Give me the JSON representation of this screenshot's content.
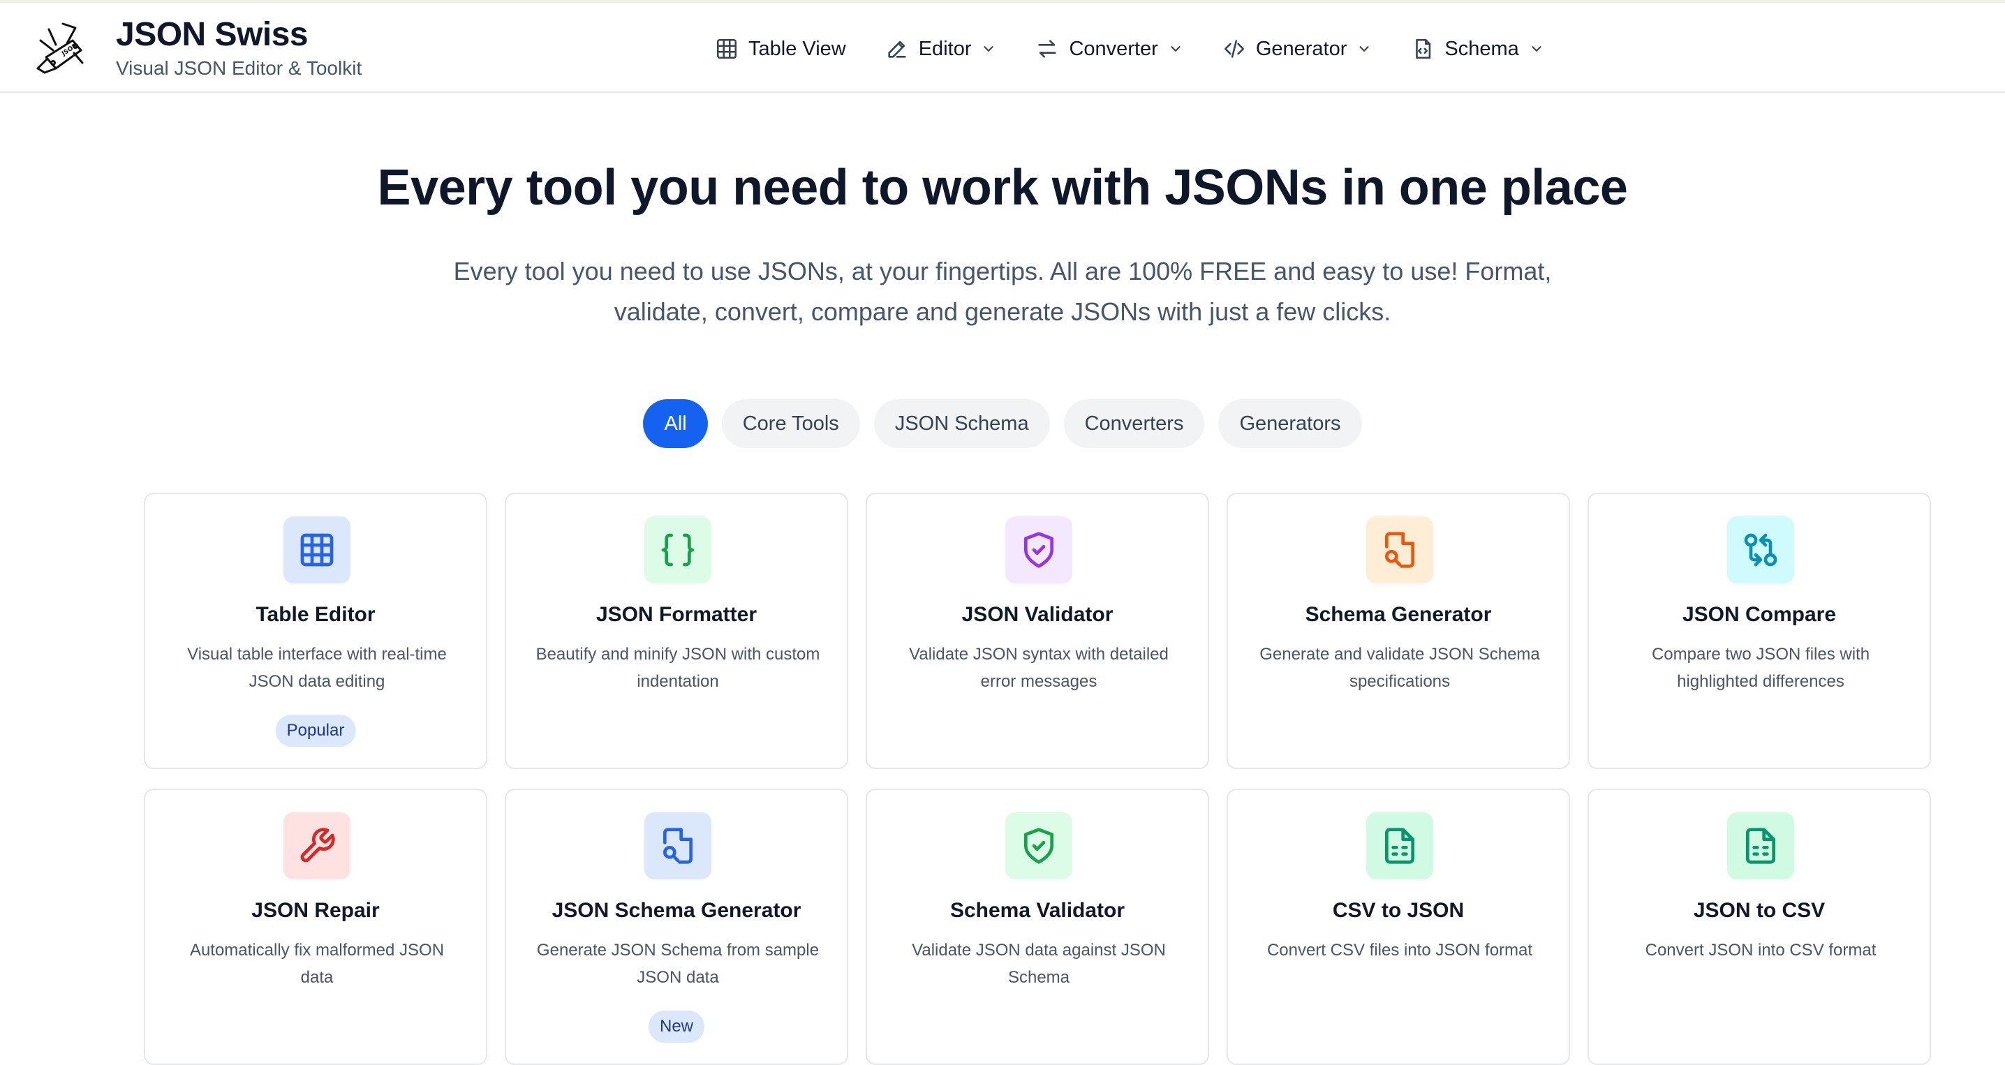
{
  "brand": {
    "title": "JSON Swiss",
    "subtitle": "Visual JSON Editor & Toolkit"
  },
  "nav": [
    {
      "label": "Table View",
      "icon": "table-icon",
      "dropdown": false
    },
    {
      "label": "Editor",
      "icon": "pencil-icon",
      "dropdown": true
    },
    {
      "label": "Converter",
      "icon": "arrows-swap-icon",
      "dropdown": true
    },
    {
      "label": "Generator",
      "icon": "code-icon",
      "dropdown": true
    },
    {
      "label": "Schema",
      "icon": "file-code-icon",
      "dropdown": true
    }
  ],
  "hero": {
    "title": "Every tool you need to work with JSONs in one place",
    "subtitle": "Every tool you need to use JSONs, at your fingertips. All are 100% FREE and easy to use! Format, validate, convert, compare and generate JSONs with just a few clicks."
  },
  "filters": [
    "All",
    "Core Tools",
    "JSON Schema",
    "Converters",
    "Generators"
  ],
  "active_filter": "All",
  "tools": [
    {
      "title": "Table Editor",
      "desc": "Visual table interface with real-time JSON data editing",
      "badge": "Popular",
      "icon": "table-grid-icon",
      "bg": "#dbe7fb",
      "fg": "#2563eb"
    },
    {
      "title": "JSON Formatter",
      "desc": "Beautify and minify JSON with custom indentation",
      "badge": "",
      "icon": "braces-icon",
      "bg": "#dcfce7",
      "fg": "#16a34a"
    },
    {
      "title": "JSON Validator",
      "desc": "Validate JSON syntax with detailed error messages",
      "badge": "",
      "icon": "shield-check-icon",
      "bg": "#f3e8ff",
      "fg": "#9333ea"
    },
    {
      "title": "Schema Generator",
      "desc": "Generate and validate JSON Schema specifications",
      "badge": "",
      "icon": "file-search-icon",
      "bg": "#ffedd5",
      "fg": "#ea580c"
    },
    {
      "title": "JSON Compare",
      "desc": "Compare two JSON files with highlighted differences",
      "badge": "",
      "icon": "git-compare-icon",
      "bg": "#cffafe",
      "fg": "#0891b2"
    },
    {
      "title": "JSON Repair",
      "desc": "Automatically fix malformed JSON data",
      "badge": "",
      "icon": "wrench-icon",
      "bg": "#fee2e2",
      "fg": "#dc2626"
    },
    {
      "title": "JSON Schema Generator",
      "desc": "Generate JSON Schema from sample JSON data",
      "badge": "New",
      "icon": "file-search-icon",
      "bg": "#dbe7fb",
      "fg": "#2563eb"
    },
    {
      "title": "Schema Validator",
      "desc": "Validate JSON data against JSON Schema",
      "badge": "",
      "icon": "shield-check-icon",
      "bg": "#dcfce7",
      "fg": "#16a34a"
    },
    {
      "title": "CSV to JSON",
      "desc": "Convert CSV files into JSON format",
      "badge": "",
      "icon": "file-spreadsheet-icon",
      "bg": "#d1fae5",
      "fg": "#059669"
    },
    {
      "title": "JSON to CSV",
      "desc": "Convert JSON into CSV format",
      "badge": "",
      "icon": "file-spreadsheet-icon",
      "bg": "#d1fae5",
      "fg": "#059669"
    }
  ]
}
